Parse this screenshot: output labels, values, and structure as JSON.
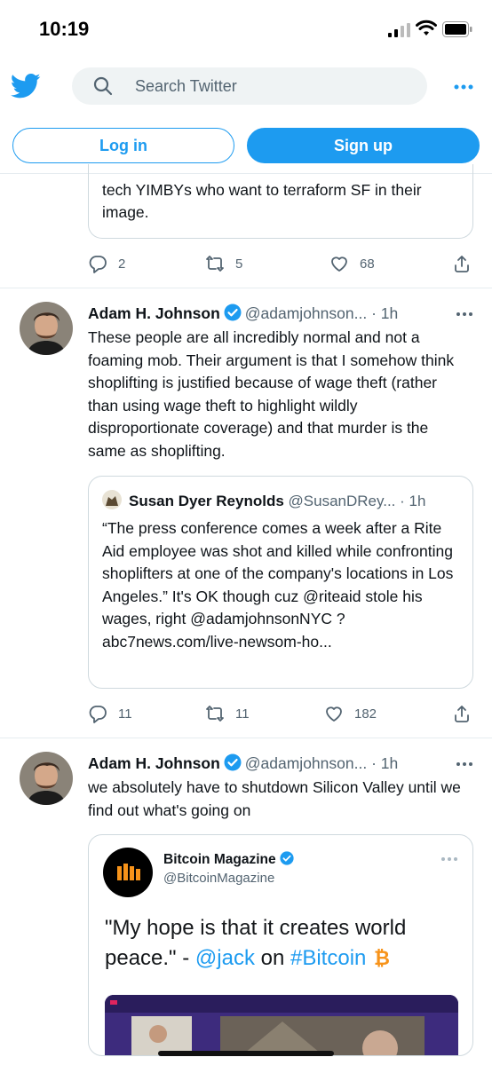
{
  "status_bar": {
    "time": "10:19"
  },
  "header": {
    "search_placeholder": "Search Twitter"
  },
  "auth": {
    "login_label": "Log in",
    "signup_label": "Sign up"
  },
  "prev_tweet": {
    "quote_text": "tech YIMBYs who want to terraform SF in their image.",
    "replies": "2",
    "retweets": "5",
    "likes": "68"
  },
  "tweet1": {
    "name": "Adam H. Johnson",
    "handle": "@adamjohnson...",
    "time": "· 1h",
    "text": "These people are all incredibly normal and not a foaming mob. Their argument is that I somehow think shoplifting is justified because of wage theft (rather than using wage theft to highlight wildly disproportionate coverage) and that murder is the same as shoplifting.",
    "quote": {
      "name": "Susan Dyer Reynolds",
      "handle": "@SusanDRey...",
      "time": "· 1h",
      "text": "“The press conference comes a week after a Rite Aid employee was shot and killed while confronting shoplifters at one of the company's locations in Los Angeles.” It's OK though cuz @riteaid stole his wages, right @adamjohnsonNYC ? abc7news.com/live-newsom-ho..."
    },
    "replies": "11",
    "retweets": "11",
    "likes": "182"
  },
  "tweet2": {
    "name": "Adam H. Johnson",
    "handle": "@adamjohnson...",
    "time": "· 1h",
    "text": "we absolutely have to shutdown Silicon Valley until we find out what's going on",
    "card": {
      "name": "Bitcoin Magazine",
      "handle": "@BitcoinMagazine",
      "quote_start": "\"My hope is that it creates world peace.\" - ",
      "mention": "@jack",
      "quote_mid": " on ",
      "hashtag": "#Bitcoin"
    }
  },
  "colors": {
    "accent": "#1d9bf0",
    "text": "#0f1419",
    "muted": "#536471",
    "border": "#cfd9de"
  }
}
